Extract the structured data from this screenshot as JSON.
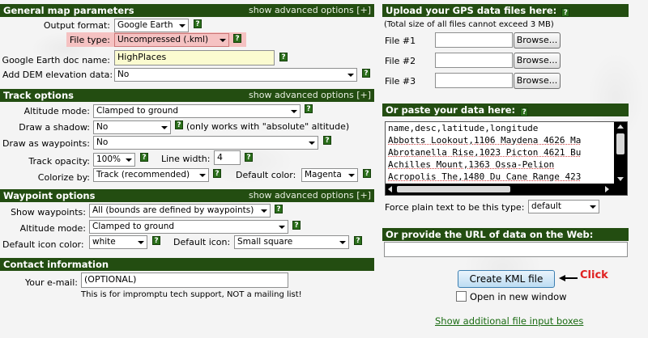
{
  "general": {
    "title": "General map parameters",
    "advanced": "show advanced options [+]",
    "output_format_label": "Output format:",
    "output_format_value": "Google Earth",
    "file_type_label": "File type:",
    "file_type_value": "Uncompressed (.kml)",
    "doc_name_label": "Google Earth doc name:",
    "doc_name_value": "HighPlaces",
    "dem_label": "Add DEM elevation data:",
    "dem_value": "No"
  },
  "track": {
    "title": "Track options",
    "advanced": "show advanced options [+]",
    "altitude_label": "Altitude mode:",
    "altitude_value": "Clamped to ground",
    "shadow_label": "Draw a shadow:",
    "shadow_value": "No",
    "shadow_note": "(only works with \"absolute\" altitude)",
    "waypoints_label": "Draw as waypoints:",
    "waypoints_value": "No",
    "opacity_label": "Track opacity:",
    "opacity_value": "100%",
    "line_width_label": "Line width:",
    "line_width_value": "4",
    "colorize_label": "Colorize by:",
    "colorize_value": "Track (recommended)",
    "default_color_label": "Default color:",
    "default_color_value": "Magenta"
  },
  "waypoint": {
    "title": "Waypoint options",
    "advanced": "show advanced options [+]",
    "show_label": "Show waypoints:",
    "show_value": "All (bounds are defined by waypoints)",
    "altitude_label": "Altitude mode:",
    "altitude_value": "Clamped to ground",
    "icon_color_label": "Default icon color:",
    "icon_color_value": "white",
    "icon_label": "Default icon:",
    "icon_value": "Small square"
  },
  "contact": {
    "title": "Contact information",
    "email_label": "Your e-mail:",
    "email_value": "(OPTIONAL)",
    "note": "This is for impromptu tech support, NOT a mailing list!"
  },
  "upload": {
    "title": "Upload your GPS data files here:",
    "subtitle": "(Total size of all files cannot exceed 3 MB)",
    "files": [
      {
        "label": "File #1",
        "button": "Browse..."
      },
      {
        "label": "File #2",
        "button": "Browse..."
      },
      {
        "label": "File #3",
        "button": "Browse..."
      }
    ]
  },
  "paste": {
    "title": "Or paste your data here:",
    "lines": [
      "name,desc,latitude,longitude",
      "Abbotts Lookout,1106 Maydena 4626 Ma",
      "Abrotanella Rise,1023 Picton 4621 Bu",
      "Achilles Mount,1363     Ossa-Pelion",
      "Acropolis The,1480 Du Cane Range 423"
    ],
    "force_label": "Force plain text to be this type:",
    "force_value": "default"
  },
  "url": {
    "title": "Or provide the URL of data on the Web:",
    "value": ""
  },
  "actions": {
    "create_label": "Create KML file",
    "click_label": "Click",
    "new_window_label": "Open in new window",
    "additional_link": "Show additional file input boxes"
  },
  "icons": {
    "help": "help-icon",
    "arrow": "arrow-left-icon"
  },
  "colors": {
    "header": "#234d11",
    "click_annotation": "#e02020",
    "file_type_highlight": "#f5c2c2"
  }
}
